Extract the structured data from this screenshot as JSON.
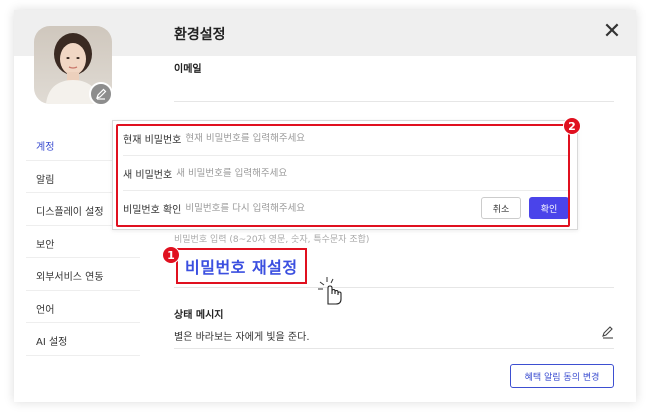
{
  "header": {
    "title": "환경설정",
    "close_symbol": "✕"
  },
  "sidebar": {
    "items": [
      {
        "label": "계정",
        "active": true
      },
      {
        "label": "알림",
        "active": false
      },
      {
        "label": "디스플레이 설정",
        "active": false
      },
      {
        "label": "보안",
        "active": false
      },
      {
        "label": "외부서비스 연동",
        "active": false
      },
      {
        "label": "언어",
        "active": false
      },
      {
        "label": "AI 설정",
        "active": false
      }
    ]
  },
  "content": {
    "email_label": "이메일",
    "password_hint": "비밀번호 입력 (8~20자 영문, 숫자, 특수문자 조합)",
    "password_reset_link": "비밀번호 재설정",
    "status_label": "상태 메시지",
    "status_message": "별은 바라보는 자에게 빛을 준다.",
    "consent_button": "혜택 알림 동의 변경"
  },
  "password_popup": {
    "current_label": "현재 비밀번호",
    "current_placeholder": "현재 비밀번호를 입력해주세요",
    "new_label": "새 비밀번호",
    "new_placeholder": "새 비밀번호를 입력해주세요",
    "confirm_label": "비밀번호 확인",
    "confirm_placeholder": "비밀번호를 다시 입력해주세요",
    "cancel_button": "취소",
    "confirm_button": "확인"
  },
  "annotations": {
    "badge_1": "1",
    "badge_2": "2"
  },
  "colors": {
    "accent": "#3d4fd1",
    "confirm_button": "#4a44ea",
    "highlight": "#e0101f",
    "header_bg": "#efefef"
  },
  "icons": {
    "close": "close-icon",
    "avatar_edit": "pencil-icon",
    "status_edit": "pencil-icon",
    "cursor": "hand-pointer-icon"
  }
}
